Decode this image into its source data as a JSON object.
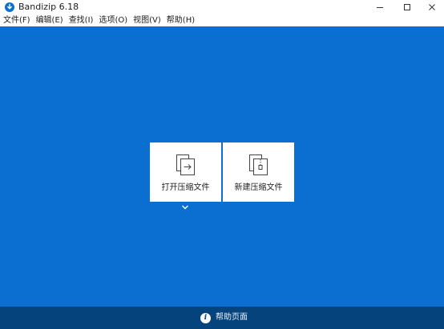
{
  "window": {
    "title": "Bandizip 6.18",
    "icons": {
      "app": "bandizip-app-icon",
      "minimize": "minimize-icon",
      "maximize": "maximize-icon",
      "close": "close-icon"
    }
  },
  "menu": {
    "items": [
      "文件(F)",
      "编辑(E)",
      "查找(I)",
      "选项(O)",
      "视图(V)",
      "帮助(H)"
    ]
  },
  "main": {
    "background": "#0a6fd1",
    "tiles": [
      {
        "label": "打开压缩文件",
        "icon": "open-archive-icon"
      },
      {
        "label": "新建压缩文件",
        "icon": "new-archive-icon"
      }
    ],
    "dropdown_icon": "chevron-down-icon"
  },
  "footer": {
    "background": "#04437c",
    "help_label": "帮助页面",
    "help_icon": "info-icon"
  }
}
